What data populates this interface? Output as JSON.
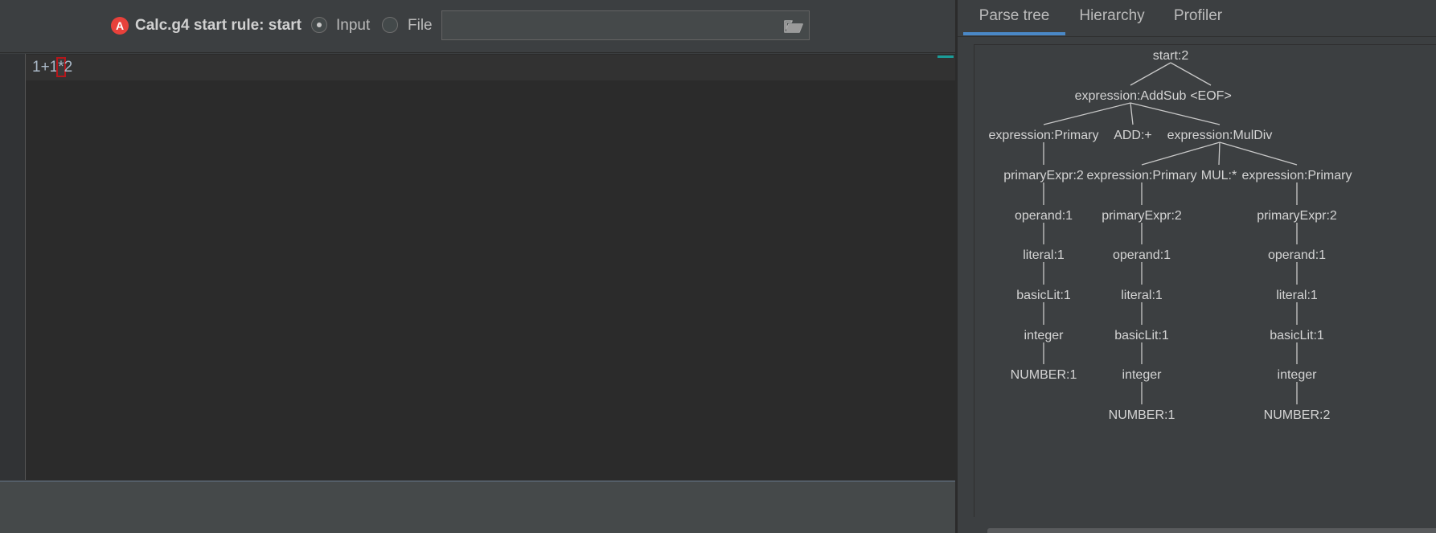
{
  "toolbar": {
    "grammar_label": "Calc.g4 start rule: start",
    "input_label": "Input",
    "file_label": "File",
    "file_path_value": "",
    "input_checked": true
  },
  "editor": {
    "code_before": "1+1",
    "code_error": "*",
    "code_after": "2"
  },
  "tabs": {
    "parse_tree": "Parse tree",
    "hierarchy": "Hierarchy",
    "profiler": "Profiler"
  },
  "colors": {
    "accent": "#4a88c7",
    "error": "#b5161b",
    "antlr_icon": "#e8413b",
    "error_marker": "#1a9c98"
  },
  "icons": {
    "grammar": "antlr-icon",
    "browse": "folder-open-icon"
  },
  "parse_tree": {
    "nodes": [
      {
        "id": "n1",
        "label": "start:2",
        "parent": null
      },
      {
        "id": "n2",
        "label": "expression:AddSub",
        "parent": "n1"
      },
      {
        "id": "n3",
        "label": "<EOF>",
        "parent": "n1"
      },
      {
        "id": "n4",
        "label": "expression:Primary",
        "parent": "n2"
      },
      {
        "id": "n5",
        "label": "ADD:+",
        "parent": "n2"
      },
      {
        "id": "n6",
        "label": "expression:MulDiv",
        "parent": "n2"
      },
      {
        "id": "n7",
        "label": "primaryExpr:2",
        "parent": "n4"
      },
      {
        "id": "n8",
        "label": "operand:1",
        "parent": "n7"
      },
      {
        "id": "n9",
        "label": "literal:1",
        "parent": "n8"
      },
      {
        "id": "n10",
        "label": "basicLit:1",
        "parent": "n9"
      },
      {
        "id": "n11",
        "label": "integer",
        "parent": "n10"
      },
      {
        "id": "n12",
        "label": "NUMBER:1",
        "parent": "n11"
      },
      {
        "id": "n13",
        "label": "expression:Primary",
        "parent": "n6"
      },
      {
        "id": "n14",
        "label": "MUL:*",
        "parent": "n6"
      },
      {
        "id": "n15",
        "label": "expression:Primary",
        "parent": "n6"
      },
      {
        "id": "n16",
        "label": "primaryExpr:2",
        "parent": "n13"
      },
      {
        "id": "n17",
        "label": "operand:1",
        "parent": "n16"
      },
      {
        "id": "n18",
        "label": "literal:1",
        "parent": "n17"
      },
      {
        "id": "n19",
        "label": "basicLit:1",
        "parent": "n18"
      },
      {
        "id": "n20",
        "label": "integer",
        "parent": "n19"
      },
      {
        "id": "n21",
        "label": "NUMBER:1",
        "parent": "n20"
      },
      {
        "id": "n22",
        "label": "primaryExpr:2",
        "parent": "n15"
      },
      {
        "id": "n23",
        "label": "operand:1",
        "parent": "n22"
      },
      {
        "id": "n24",
        "label": "literal:1",
        "parent": "n23"
      },
      {
        "id": "n25",
        "label": "basicLit:1",
        "parent": "n24"
      },
      {
        "id": "n26",
        "label": "integer",
        "parent": "n25"
      },
      {
        "id": "n27",
        "label": "NUMBER:2",
        "parent": "n26"
      }
    ]
  }
}
